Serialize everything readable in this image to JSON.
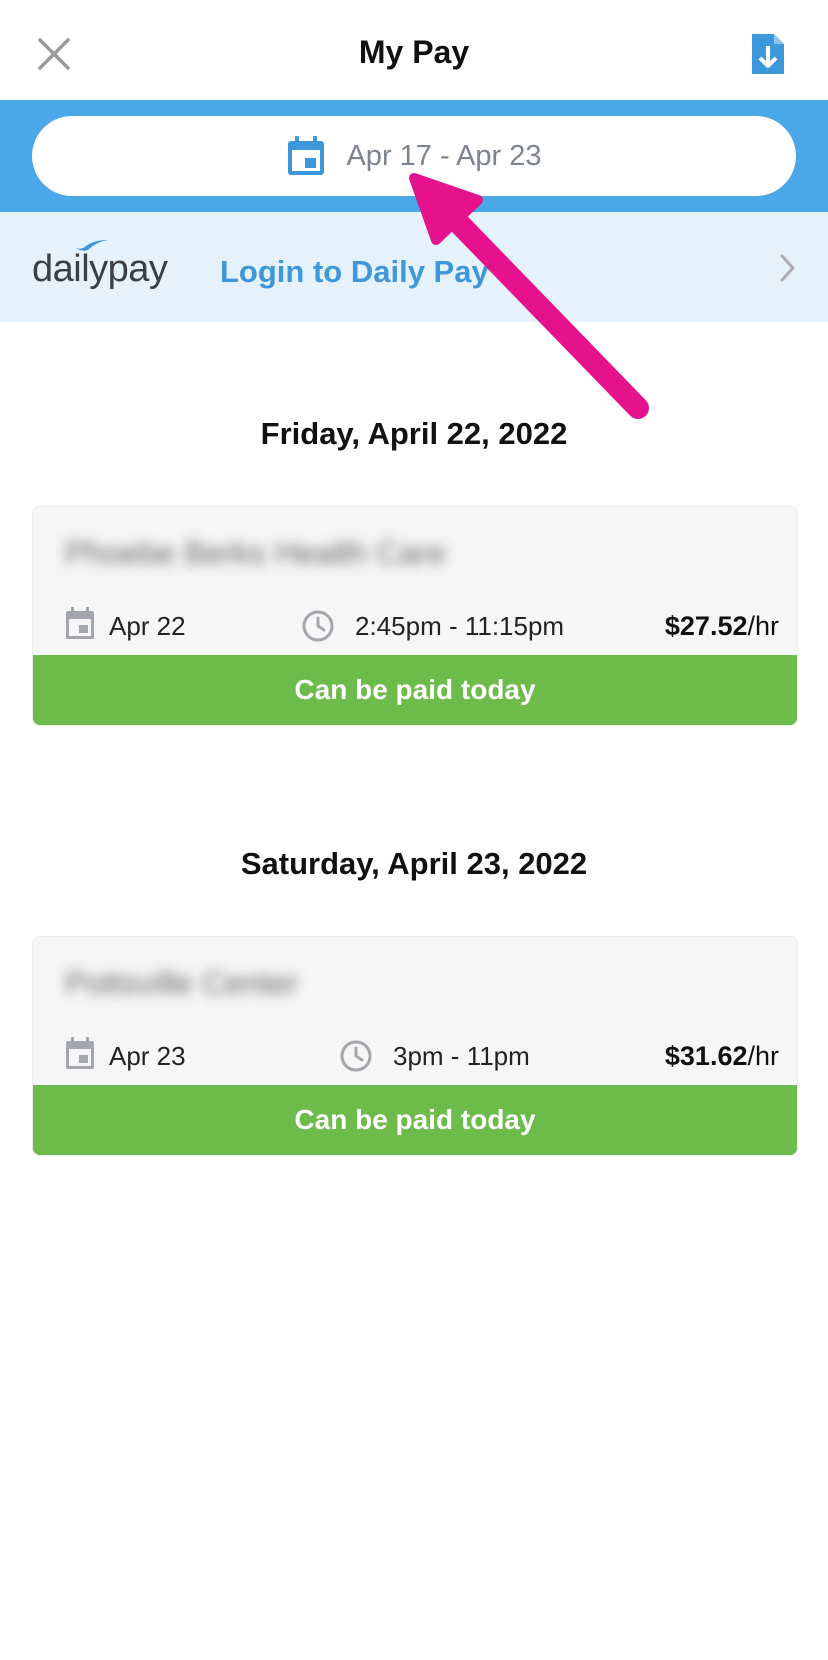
{
  "header": {
    "title": "My Pay",
    "close_icon": "close-icon",
    "download_icon": "download-file-icon"
  },
  "date_range": {
    "label": "Apr 17 - Apr 23",
    "icon": "calendar-icon"
  },
  "dailypay": {
    "logo_text": "dailypay",
    "link_label": "Login to Daily Pay",
    "chevron_icon": "chevron-right-icon"
  },
  "shifts": [
    {
      "day_heading": "Friday, April 22, 2022",
      "facility": "Phoebe Berks Health Care",
      "date": "Apr 22",
      "time": "2:45pm - 11:15pm",
      "rate_amount": "$27.52",
      "rate_unit": "/hr",
      "status": "Can be paid today"
    },
    {
      "day_heading": "Saturday, April 23, 2022",
      "facility": "Pottsville Center",
      "date": "Apr 23",
      "time": "3pm - 11pm",
      "rate_amount": "$31.62",
      "rate_unit": "/hr",
      "status": "Can be paid today"
    }
  ],
  "colors": {
    "brand_blue": "#4aa8e8",
    "link_blue": "#3d97db",
    "success_green": "#6dbb4a",
    "annotation_pink": "#e6118c"
  }
}
